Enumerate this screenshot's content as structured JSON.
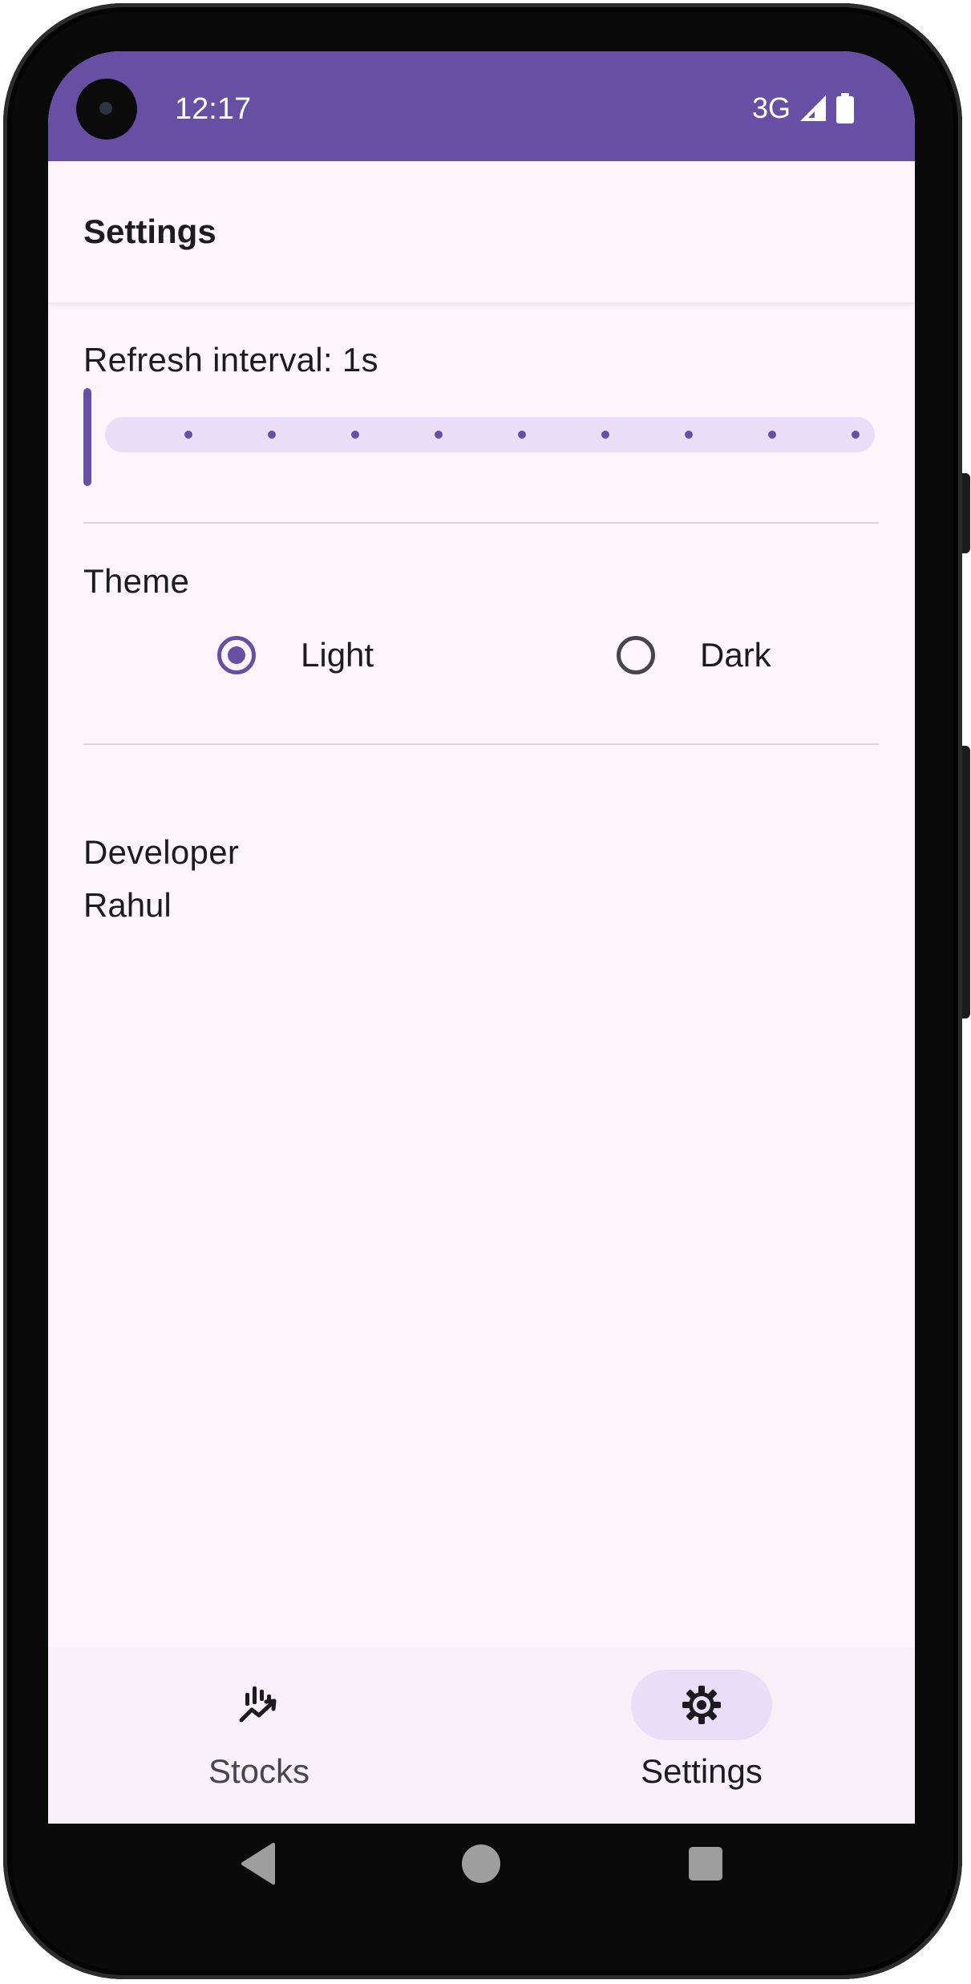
{
  "status_bar": {
    "time": "12:17",
    "network": "3G",
    "icons": [
      "camera-cutout-icon",
      "signal-icon",
      "battery-icon"
    ],
    "color": "#6750a4"
  },
  "top_bar": {
    "title": "Settings"
  },
  "refresh": {
    "label": "Refresh interval: 1s",
    "value": 1,
    "min": 1,
    "max": 10,
    "steps": 10
  },
  "theme": {
    "label": "Theme",
    "options": [
      {
        "label": "Light",
        "selected": true
      },
      {
        "label": "Dark",
        "selected": false
      }
    ]
  },
  "developer": {
    "label": "Developer",
    "name": "Rahul"
  },
  "bottom_nav": {
    "items": [
      {
        "label": "Stocks",
        "icon": "stocks-chart-icon",
        "active": false
      },
      {
        "label": "Settings",
        "icon": "gear-icon",
        "active": true
      }
    ]
  },
  "system_nav": {
    "icons": [
      "back-icon",
      "home-icon",
      "recents-icon"
    ]
  },
  "colors": {
    "primary": "#6750a4",
    "background": "#fcf5fc",
    "track": "#e8def8"
  }
}
